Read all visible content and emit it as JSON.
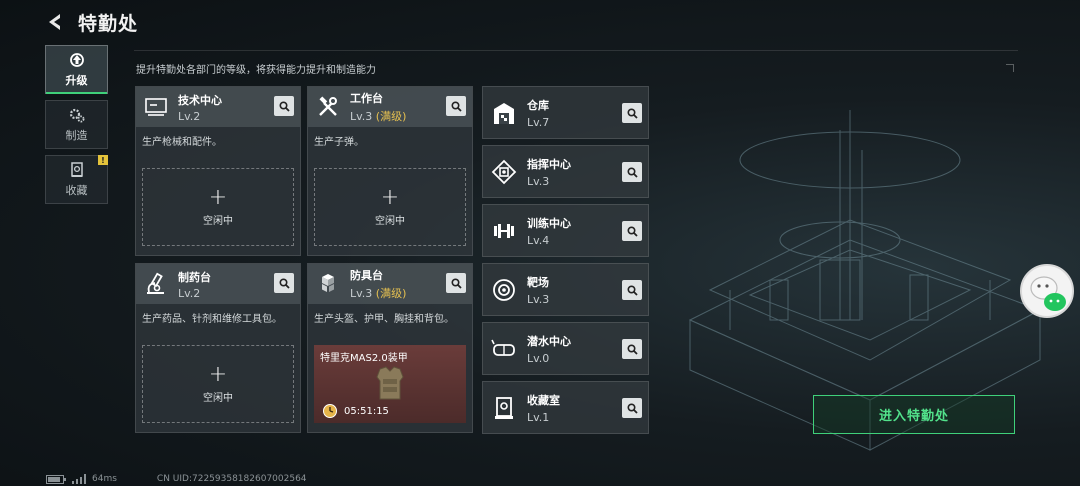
{
  "header": {
    "title": "特勤处"
  },
  "sidebar": {
    "tabs": [
      {
        "label": "升级",
        "active": true,
        "icon": "upgrade-icon"
      },
      {
        "label": "制造",
        "active": false,
        "icon": "gears-icon"
      },
      {
        "label": "收藏",
        "active": false,
        "icon": "collection-icon",
        "badge": "!"
      }
    ]
  },
  "subtitle": "提升特勤处各部门的等级，将获得能力提升和制造能力",
  "cards": [
    {
      "name": "技术中心",
      "level": "Lv.2",
      "max": "",
      "desc": "生产枪械和配件。",
      "slot_idle": "空闲中",
      "icon": "monitor-icon"
    },
    {
      "name": "工作台",
      "level": "Lv.3",
      "max": "(满级)",
      "desc": "生产子弹。",
      "slot_idle": "空闲中",
      "icon": "tools-icon"
    },
    {
      "name": "制药台",
      "level": "Lv.2",
      "max": "",
      "desc": "生产药品、针剂和维修工具包。",
      "slot_idle": "空闲中",
      "icon": "microscope-icon"
    },
    {
      "name": "防具台",
      "level": "Lv.3",
      "max": "(满级)",
      "desc": "生产头盔、护甲、胸挂和背包。",
      "icon": "boxes-icon",
      "production": {
        "item": "特里克MAS2.0装甲",
        "time": "05:51:15"
      }
    }
  ],
  "rooms": [
    {
      "name": "仓库",
      "level": "Lv.7",
      "icon": "warehouse-icon"
    },
    {
      "name": "指挥中心",
      "level": "Lv.3",
      "icon": "command-chip-icon"
    },
    {
      "name": "训练中心",
      "level": "Lv.4",
      "icon": "dumbbell-icon"
    },
    {
      "name": "靶场",
      "level": "Lv.3",
      "icon": "target-icon"
    },
    {
      "name": "潜水中心",
      "level": "Lv.0",
      "icon": "diving-mask-icon"
    },
    {
      "name": "收藏室",
      "level": "Lv.1",
      "icon": "display-case-icon"
    }
  ],
  "enter_button": "进入特勤处",
  "footer": {
    "ping": "64ms",
    "uid": "CN UID:72259358182607002564"
  },
  "colors": {
    "accent": "#3fd07a",
    "max_level": "#e5c050",
    "production_bg": "#6a3c3a"
  }
}
